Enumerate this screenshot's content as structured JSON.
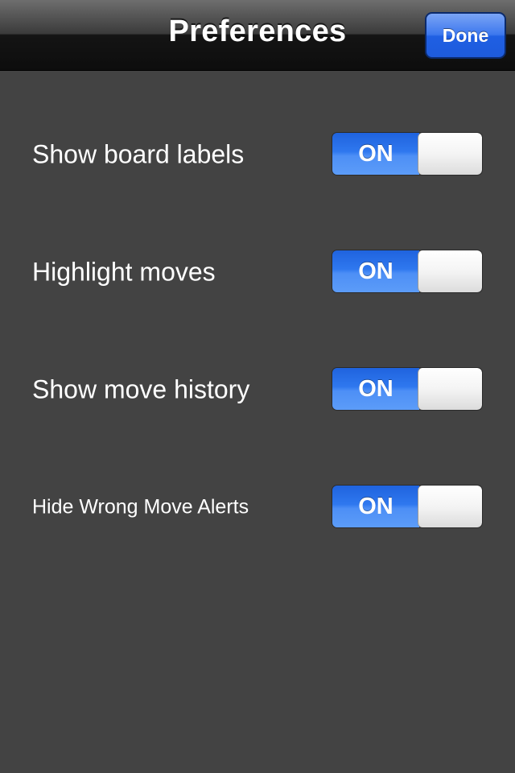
{
  "navbar": {
    "title": "Preferences",
    "done_label": "Done"
  },
  "preferences": [
    {
      "label": "Show board labels",
      "state": "ON",
      "on": true
    },
    {
      "label": "Highlight moves",
      "state": "ON",
      "on": true
    },
    {
      "label": "Show move history",
      "state": "ON",
      "on": true
    },
    {
      "label": "Hide Wrong Move Alerts",
      "state": "ON",
      "on": true
    }
  ],
  "colors": {
    "background": "#434343",
    "switch_on": "#2f78ef",
    "done_button": "#3d78ee"
  }
}
